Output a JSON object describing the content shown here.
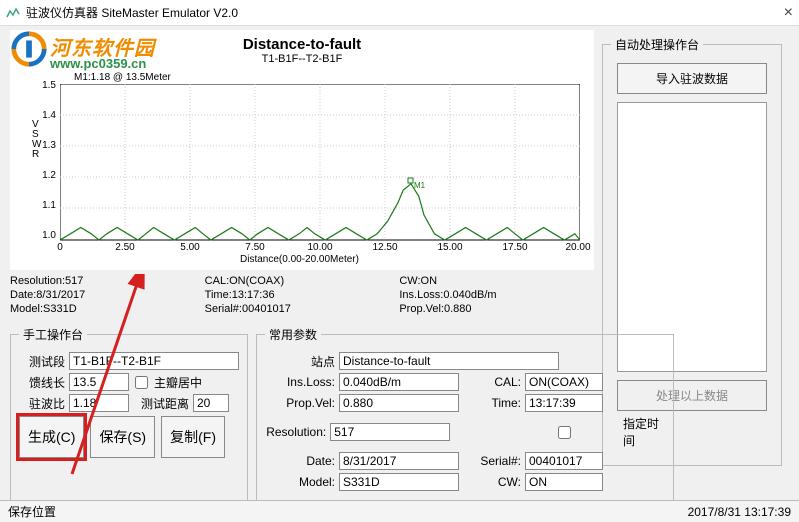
{
  "window": {
    "title": "驻波仪仿真器 SiteMaster Emulator V2.0"
  },
  "watermark": {
    "text1": "河东软件园",
    "text2": "www.pc0359.cn"
  },
  "chart": {
    "title": "Distance-to-fault",
    "subtitle": "T1-B1F--T2-B1F",
    "m1_label": "M1:1.18 @ 13.5Meter",
    "xlabel": "Distance(0.00-20.00Meter)",
    "m1_marker": "M1"
  },
  "chart_data": {
    "type": "line",
    "title": "Distance-to-fault",
    "xlabel": "Distance(0.00-20.00Meter)",
    "ylabel": "VSWR",
    "xlim": [
      0,
      20
    ],
    "ylim": [
      1.0,
      1.5
    ],
    "xticks": [
      0,
      2.5,
      5.0,
      7.5,
      10.0,
      12.5,
      15.0,
      17.5,
      20.0
    ],
    "yticks": [
      1.0,
      1.1,
      1.2,
      1.3,
      1.4,
      1.5
    ],
    "series": [
      {
        "name": "VSWR",
        "x": [
          0,
          0.4,
          0.8,
          1.2,
          1.5,
          1.8,
          2.2,
          2.6,
          3.0,
          3.3,
          3.6,
          4.0,
          4.4,
          4.8,
          5.2,
          5.5,
          5.8,
          6.2,
          6.6,
          7.0,
          7.3,
          7.6,
          8.0,
          8.4,
          8.8,
          9.2,
          9.5,
          9.8,
          10.2,
          10.6,
          11.0,
          11.4,
          11.8,
          12.2,
          12.6,
          13.0,
          13.2,
          13.5,
          13.8,
          14.0,
          14.4,
          14.8,
          15.2,
          15.6,
          16.0,
          16.4,
          16.8,
          17.2,
          17.5,
          17.8,
          18.2,
          18.6,
          19.0,
          19.4,
          19.8,
          20.0
        ],
        "values": [
          1.0,
          1.02,
          1.04,
          1.02,
          1.0,
          1.02,
          1.04,
          1.02,
          1.0,
          1.02,
          1.04,
          1.02,
          1.0,
          1.02,
          1.04,
          1.02,
          1.0,
          1.02,
          1.04,
          1.02,
          1.0,
          1.02,
          1.04,
          1.02,
          1.0,
          1.02,
          1.04,
          1.02,
          1.0,
          1.02,
          1.04,
          1.02,
          1.0,
          1.02,
          1.06,
          1.12,
          1.16,
          1.18,
          1.14,
          1.08,
          1.02,
          1.0,
          1.02,
          1.04,
          1.02,
          1.0,
          1.02,
          1.04,
          1.02,
          1.0,
          1.02,
          1.04,
          1.02,
          1.0,
          1.02,
          1.0
        ]
      }
    ],
    "markers": [
      {
        "name": "M1",
        "x": 13.5,
        "y": 1.18
      }
    ]
  },
  "info": {
    "col1": {
      "resolution": "Resolution:517",
      "date": "Date:8/31/2017",
      "model": "Model:S331D"
    },
    "col2": {
      "cal": "CAL:ON(COAX)",
      "time": "Time:13:17:36",
      "serial": "Serial#:00401017"
    },
    "col3": {
      "cw": "CW:ON",
      "insloss": "Ins.Loss:0.040dB/m",
      "propvel": "Prop.Vel:0.880"
    }
  },
  "manual": {
    "legend": "手工操作台",
    "test_label": "测试段",
    "test_val": "T1-B1F--T2-B1F",
    "feed_label": "馈线长",
    "feed_val": "13.5",
    "mainlobe_label": "主瓣居中",
    "vswr_label": "驻波比",
    "vswr_val": "1.18",
    "dist_label": "测试距离",
    "dist_val": "20",
    "btn_gen": "生成(C)",
    "btn_save": "保存(S)",
    "btn_copy": "复制(F)"
  },
  "common": {
    "legend": "常用参数",
    "site_label": "站点",
    "site_val": "Distance-to-fault",
    "insloss_label": "Ins.Loss:",
    "insloss_val": "0.040dB/m",
    "cal_label": "CAL:",
    "cal_val": "ON(COAX)",
    "propvel_label": "Prop.Vel:",
    "propvel_val": "0.880",
    "time_label": "Time:",
    "time_val": "13:17:39",
    "res_label": "Resolution:",
    "res_val": "517",
    "spectime_label": "指定时间",
    "date_label": "Date:",
    "date_val": "8/31/2017",
    "serial_label": "Serial#:",
    "serial_val": "00401017",
    "model_label": "Model:",
    "model_val": "S331D",
    "cw_label": "CW:",
    "cw_val": "ON"
  },
  "auto": {
    "legend": "自动处理操作台",
    "import_btn": "导入驻波数据",
    "process_btn": "处理以上数据"
  },
  "status": {
    "left": "保存位置",
    "right": "2017/8/31 13:17:39"
  }
}
